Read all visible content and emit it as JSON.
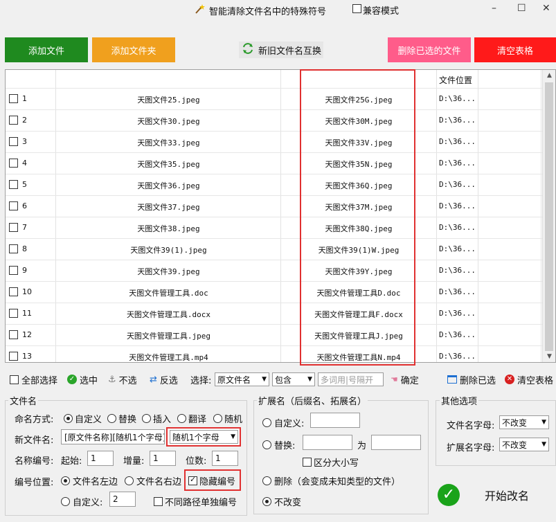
{
  "title": {
    "text": "智能清除文件名中的特殊符号",
    "compat_label": "兼容模式",
    "icon": "wand-icon"
  },
  "window_controls": {
    "minimize": "–",
    "maximize": "☐",
    "close": "✕"
  },
  "top_buttons": {
    "add_file": "添加文件",
    "add_folder": "添加文件夹",
    "swap": "新旧文件名互换",
    "delete_selected": "删除已选的文件",
    "clear_table": "清空表格"
  },
  "table": {
    "location_header": "文件位置",
    "rows": [
      {
        "num": "1",
        "old": "天图文件25.jpeg",
        "new": "天图文件25G.jpeg",
        "loc": "D:\\36..."
      },
      {
        "num": "2",
        "old": "天图文件30.jpeg",
        "new": "天图文件30M.jpeg",
        "loc": "D:\\36..."
      },
      {
        "num": "3",
        "old": "天图文件33.jpeg",
        "new": "天图文件33V.jpeg",
        "loc": "D:\\36..."
      },
      {
        "num": "4",
        "old": "天图文件35.jpeg",
        "new": "天图文件35N.jpeg",
        "loc": "D:\\36..."
      },
      {
        "num": "5",
        "old": "天图文件36.jpeg",
        "new": "天图文件36Q.jpeg",
        "loc": "D:\\36..."
      },
      {
        "num": "6",
        "old": "天图文件37.jpeg",
        "new": "天图文件37M.jpeg",
        "loc": "D:\\36..."
      },
      {
        "num": "7",
        "old": "天图文件38.jpeg",
        "new": "天图文件38Q.jpeg",
        "loc": "D:\\36..."
      },
      {
        "num": "8",
        "old": "天图文件39(1).jpeg",
        "new": "天图文件39(1)W.jpeg",
        "loc": "D:\\36..."
      },
      {
        "num": "9",
        "old": "天图文件39.jpeg",
        "new": "天图文件39Y.jpeg",
        "loc": "D:\\36..."
      },
      {
        "num": "10",
        "old": "天图文件管理工具.doc",
        "new": "天图文件管理工具D.doc",
        "loc": "D:\\36..."
      },
      {
        "num": "11",
        "old": "天图文件管理工具.docx",
        "new": "天图文件管理工具F.docx",
        "loc": "D:\\36..."
      },
      {
        "num": "12",
        "old": "天图文件管理工具.jpeg",
        "new": "天图文件管理工具J.jpeg",
        "loc": "D:\\36..."
      },
      {
        "num": "13",
        "old": "天图文件管理工具.mp4",
        "new": "天图文件管理工具N.mp4",
        "loc": "D:\\36..."
      }
    ]
  },
  "toolbar": {
    "select_all": "全部选择",
    "select": "选中",
    "deselect": "不选",
    "invert": "反选",
    "choose_label": "选择:",
    "choose_field": "原文件名",
    "choose_op": "包含",
    "keyword_placeholder": "多词用|号隔开",
    "confirm": "确定",
    "delete_selected": "删除已选",
    "clear_table": "清空表格"
  },
  "filename_group": {
    "title": "文件名",
    "mode_label": "命名方式:",
    "modes": [
      "自定义",
      "替换",
      "插入",
      "翻译",
      "随机"
    ],
    "new_name_label": "新文件名:",
    "new_name_value": "[原文件名称][随机1个字母]",
    "new_name_dropdown": "随机1个字母",
    "numbering_label": "名称编号:",
    "start_label": "起始:",
    "start_value": "1",
    "step_label": "增量:",
    "step_value": "1",
    "digits_label": "位数:",
    "digits_value": "1",
    "position_label": "编号位置:",
    "pos_left": "文件名左边",
    "pos_right": "文件名右边",
    "hide_number": "隐藏编号",
    "pos_custom": "自定义:",
    "custom_value": "2",
    "separate_numbering": "不同路径单独编号"
  },
  "ext_group": {
    "title": "扩展名（后缀名、拓展名）",
    "custom": "自定义:",
    "replace": "替换:",
    "to": "为",
    "case_sensitive": "区分大小写",
    "delete": "删除（会变成未知类型的文件）",
    "no_change": "不改变"
  },
  "other_group": {
    "title": "其他选项",
    "filename_case_label": "文件名字母:",
    "filename_case_value": "不改变",
    "ext_case_label": "扩展名字母:",
    "ext_case_value": "不改变"
  },
  "start_button": "开始改名"
}
